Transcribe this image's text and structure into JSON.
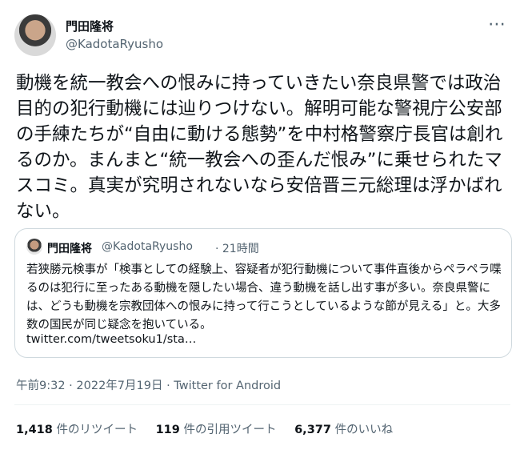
{
  "author": {
    "name": "門田隆将",
    "handle": "@KadotaRyusho"
  },
  "more_icon": "⋯",
  "tweet_text": "動機を統一教会への恨みに持っていきたい奈良県警では政治目的の犯行動機には辿りつけない。解明可能な警視庁公安部の手練たちが“自由に動ける態勢”を中村格警察庁長官は創れるのか。まんまと“統一教会への歪んだ恨み”に乗せられたマスコミ。真実が究明されないなら安倍晋三元総理は浮かばれない。",
  "quoted": {
    "name": "門田隆将",
    "handle": "@KadotaRyusho",
    "time": "· 21時間",
    "text": "若狭勝元検事が「検事としての経験上、容疑者が犯行動機について事件直後からペラペラ喋るのは犯行に至ったある動機を隠したい場合、違う動機を話し出す事が多い。奈良県警には、どうも動機を宗教団体への恨みに持って行こうとしているような節が見える」と。大多数の国民が同じ疑念を抱いている。",
    "link": "twitter.com/tweetsoku1/sta…"
  },
  "meta": "午前9:32 · 2022年7月19日 · Twitter for Android",
  "stats": {
    "retweets_num": "1,418",
    "retweets_label": "件のリツイート",
    "quotes_num": "119",
    "quotes_label": "件の引用ツイート",
    "likes_num": "6,377",
    "likes_label": "件のいいね"
  }
}
